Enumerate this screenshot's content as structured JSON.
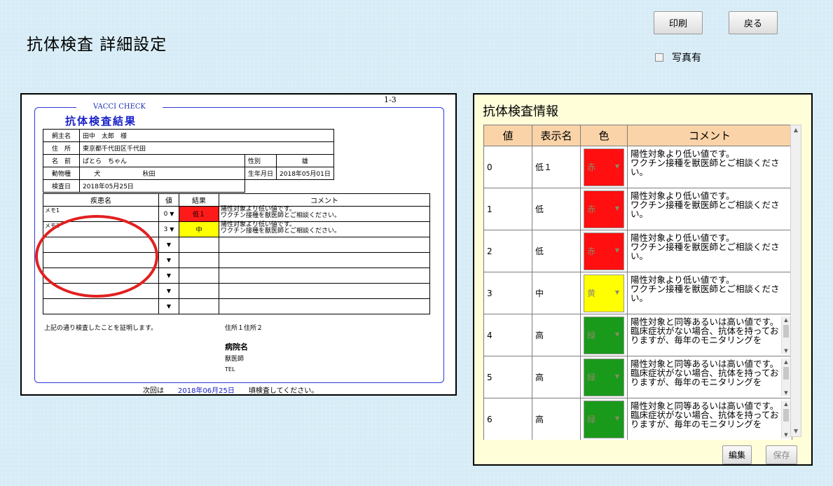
{
  "header": {
    "title": "抗体検査 詳細設定",
    "print_label": "印刷",
    "back_label": "戻る",
    "photo_label": "写真有",
    "photo_checked": false
  },
  "preview": {
    "page_number": "1-3",
    "brand": "VACCI CHECK",
    "title": "抗体検査結果",
    "owner_label": "飼主名",
    "owner_value": "田中　太郎　様",
    "address_label": "住　所",
    "address_value": "東京都千代田区千代田",
    "name_label": "名　前",
    "name_value": "ぱとら　ちゃん",
    "sex_label": "性別",
    "sex_value": "雄",
    "species_label": "動物種",
    "species_value": "犬",
    "breed_value": "秋田",
    "birth_label": "生年月日",
    "birth_value": "2018年05月01日",
    "exam_date_label": "検査日",
    "exam_date_value": "2018年05月25日",
    "col_disease": "疾患名",
    "col_value": "値",
    "col_result": "結果",
    "col_comment": "コメント",
    "rows": [
      {
        "disease": "メモ1",
        "value": "0",
        "result": "低１",
        "result_color": "#ff1a1a",
        "comment1": "陽性対象より低い値です。",
        "comment2": "ワクチン接種を獣医師とご相談ください。"
      },
      {
        "disease": "メモ2",
        "value": "3",
        "result": "中",
        "result_color": "#ffff00",
        "comment1": "陽性対象より低い値です。",
        "comment2": "ワクチン接種を獣医師とご相談ください。"
      },
      {
        "disease": "",
        "value": "",
        "result": "",
        "result_color": "",
        "comment1": "",
        "comment2": ""
      },
      {
        "disease": "",
        "value": "",
        "result": "",
        "result_color": "",
        "comment1": "",
        "comment2": ""
      },
      {
        "disease": "",
        "value": "",
        "result": "",
        "result_color": "",
        "comment1": "",
        "comment2": ""
      },
      {
        "disease": "",
        "value": "",
        "result": "",
        "result_color": "",
        "comment1": "",
        "comment2": ""
      },
      {
        "disease": "",
        "value": "",
        "result": "",
        "result_color": "",
        "comment1": "",
        "comment2": ""
      }
    ],
    "certify_text": "上記の通り検査したことを証明します。",
    "address_footer": "住所１住所２",
    "hospital": "病院名",
    "vet": "獣医師",
    "tel": "TEL",
    "next_prefix": "次回は",
    "next_date": "2018年06月25日",
    "next_suffix": "頃検査してください。"
  },
  "info": {
    "title": "抗体検査情報",
    "col_value": "値",
    "col_label": "表示名",
    "col_color": "色",
    "col_comment": "コメント",
    "rows": [
      {
        "value": "0",
        "label": "低１",
        "color_name": "赤",
        "color": "#ff0f0f",
        "comment": "陽性対象より低い値です。\nワクチン接種を獣医師とご相談ください。",
        "scroll": false
      },
      {
        "value": "1",
        "label": "低",
        "color_name": "赤",
        "color": "#ff0f0f",
        "comment": "陽性対象より低い値です。\nワクチン接種を獣医師とご相談ください。",
        "scroll": false
      },
      {
        "value": "2",
        "label": "低",
        "color_name": "赤",
        "color": "#ff0f0f",
        "comment": "陽性対象より低い値です。\nワクチン接種を獣医師とご相談ください。",
        "scroll": false
      },
      {
        "value": "3",
        "label": "中",
        "color_name": "黄",
        "color": "#ffff00",
        "comment": "陽性対象より低い値です。\nワクチン接種を獣医師とご相談ください。",
        "scroll": false
      },
      {
        "value": "4",
        "label": "高",
        "color_name": "緑",
        "color": "#1a9a1a",
        "comment": "陽性対象と同等あるいは高い値です。\n臨床症状がない場合、抗体を持っておりますが、毎年のモニタリングを",
        "scroll": true
      },
      {
        "value": "5",
        "label": "高",
        "color_name": "緑",
        "color": "#1a9a1a",
        "comment": "陽性対象と同等あるいは高い値です。\n臨床症状がない場合、抗体を持っておりますが、毎年のモニタリングを",
        "scroll": true
      },
      {
        "value": "6",
        "label": "高",
        "color_name": "緑",
        "color": "#1a9a1a",
        "comment": "陽性対象と同等あるいは高い値です。\n臨床症状がない場合、抗体を持っておりますが、毎年のモニタリングを",
        "scroll": true
      }
    ],
    "edit_label": "編集",
    "save_label": "保存"
  }
}
